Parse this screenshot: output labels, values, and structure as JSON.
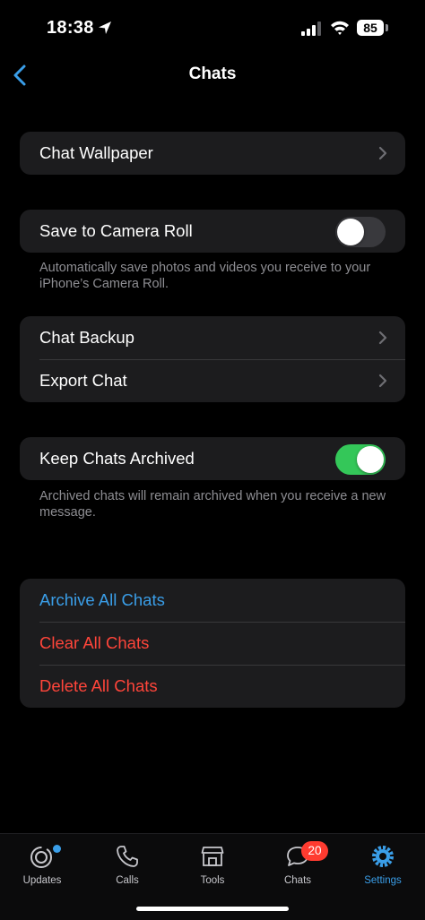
{
  "status_bar": {
    "time": "18:38",
    "battery": "85"
  },
  "nav": {
    "title": "Chats"
  },
  "wallpaper_group": {
    "chat_wallpaper": "Chat Wallpaper"
  },
  "camera_roll": {
    "label": "Save to Camera Roll",
    "enabled": false,
    "footnote": "Automatically save photos and videos you receive to your iPhone’s Camera Roll."
  },
  "backup_group": {
    "chat_backup": "Chat Backup",
    "export_chat": "Export Chat"
  },
  "archived": {
    "label": "Keep Chats Archived",
    "enabled": true,
    "footnote": "Archived chats will remain archived when you receive a new message."
  },
  "actions": {
    "archive_all": "Archive All Chats",
    "clear_all": "Clear All Chats",
    "delete_all": "Delete All Chats"
  },
  "tab_bar": {
    "updates": "Updates",
    "calls": "Calls",
    "tools": "Tools",
    "chats": "Chats",
    "chats_badge": "20",
    "settings": "Settings"
  },
  "colors": {
    "accent": "#3a9ee8",
    "destructive": "#ff453a",
    "toggle_on": "#34c759",
    "cell": "#1c1c1e"
  }
}
